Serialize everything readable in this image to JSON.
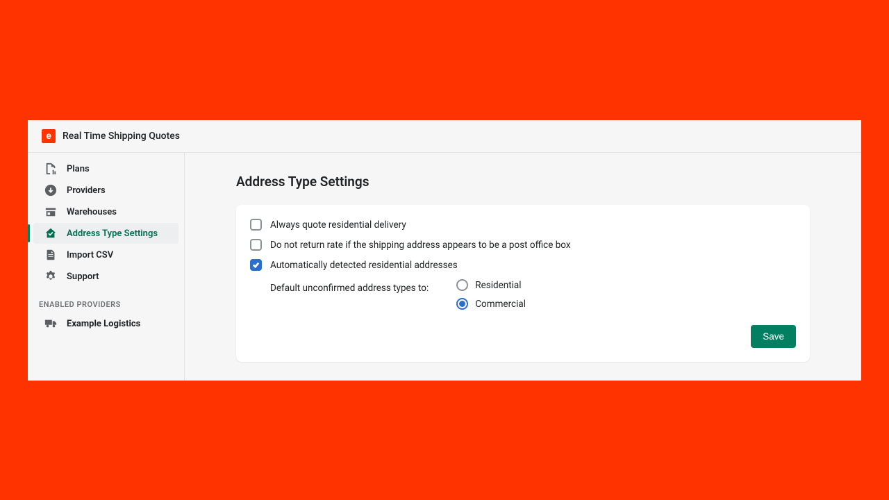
{
  "header": {
    "logo_letter": "e",
    "title": "Real Time Shipping Quotes"
  },
  "sidebar": {
    "items": [
      {
        "label": "Plans"
      },
      {
        "label": "Providers"
      },
      {
        "label": "Warehouses"
      },
      {
        "label": "Address Type Settings"
      },
      {
        "label": "Import CSV"
      },
      {
        "label": "Support"
      }
    ],
    "section_header": "ENABLED PROVIDERS",
    "providers": [
      {
        "label": "Example Logistics"
      }
    ]
  },
  "main": {
    "page_title": "Address Type Settings",
    "checkboxes": [
      {
        "label": "Always quote residential delivery",
        "checked": false
      },
      {
        "label": "Do not return rate if the shipping address appears to be a post office box",
        "checked": false
      },
      {
        "label": "Automatically detected residential addresses",
        "checked": true
      }
    ],
    "default_label": "Default unconfirmed address types to:",
    "radio_options": [
      {
        "label": "Residential",
        "selected": false
      },
      {
        "label": "Commercial",
        "selected": true
      }
    ],
    "save_label": "Save"
  },
  "colors": {
    "brand": "#ff3300",
    "accent_green": "#008060",
    "accent_blue": "#2c6ecb"
  }
}
